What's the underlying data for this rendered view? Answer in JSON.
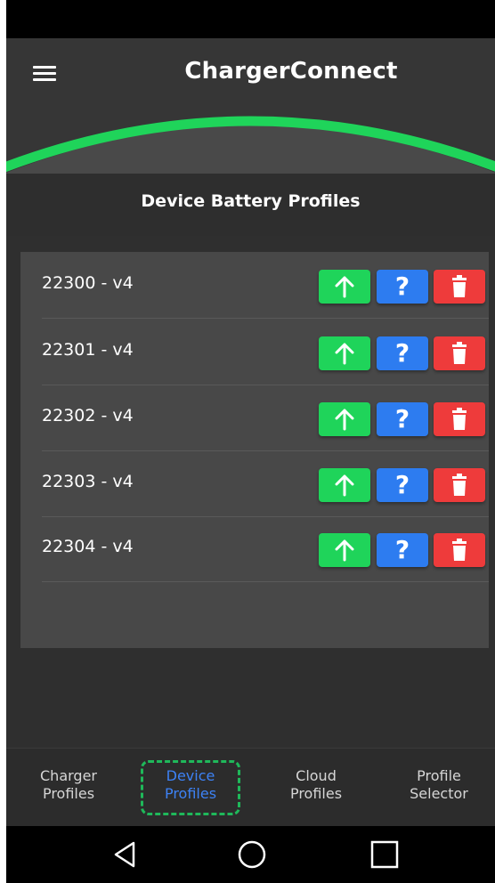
{
  "app": {
    "title": "ChargerConnect"
  },
  "header": {
    "menu_icon": "hamburger-menu-icon",
    "accent_color": "#1fd45a"
  },
  "section": {
    "title": "Device Battery Profiles"
  },
  "profiles": [
    {
      "name": "22300 - v4"
    },
    {
      "name": "22301 - v4"
    },
    {
      "name": "22302 - v4"
    },
    {
      "name": "22303 - v4"
    },
    {
      "name": "22304 - v4"
    }
  ],
  "row_actions": {
    "upload": {
      "icon": "arrow-up-icon",
      "color": "#1fd45a"
    },
    "help": {
      "icon": "question-mark-icon",
      "glyph": "?",
      "color": "#2d7cf0"
    },
    "delete": {
      "icon": "trash-icon",
      "color": "#ee3b3b"
    }
  },
  "bottom_nav": {
    "active_color": "#3d82f5",
    "tabs": [
      {
        "line1": "Charger",
        "line2": "Profiles",
        "active": false
      },
      {
        "line1": "Device",
        "line2": "Profiles",
        "active": true
      },
      {
        "line1": "Cloud",
        "line2": "Profiles",
        "active": false
      },
      {
        "line1": "Profile",
        "line2": "Selector",
        "active": false
      }
    ]
  },
  "system_nav": {
    "back_icon": "back-triangle-icon",
    "home_icon": "home-circle-icon",
    "recents_icon": "recents-square-icon"
  }
}
